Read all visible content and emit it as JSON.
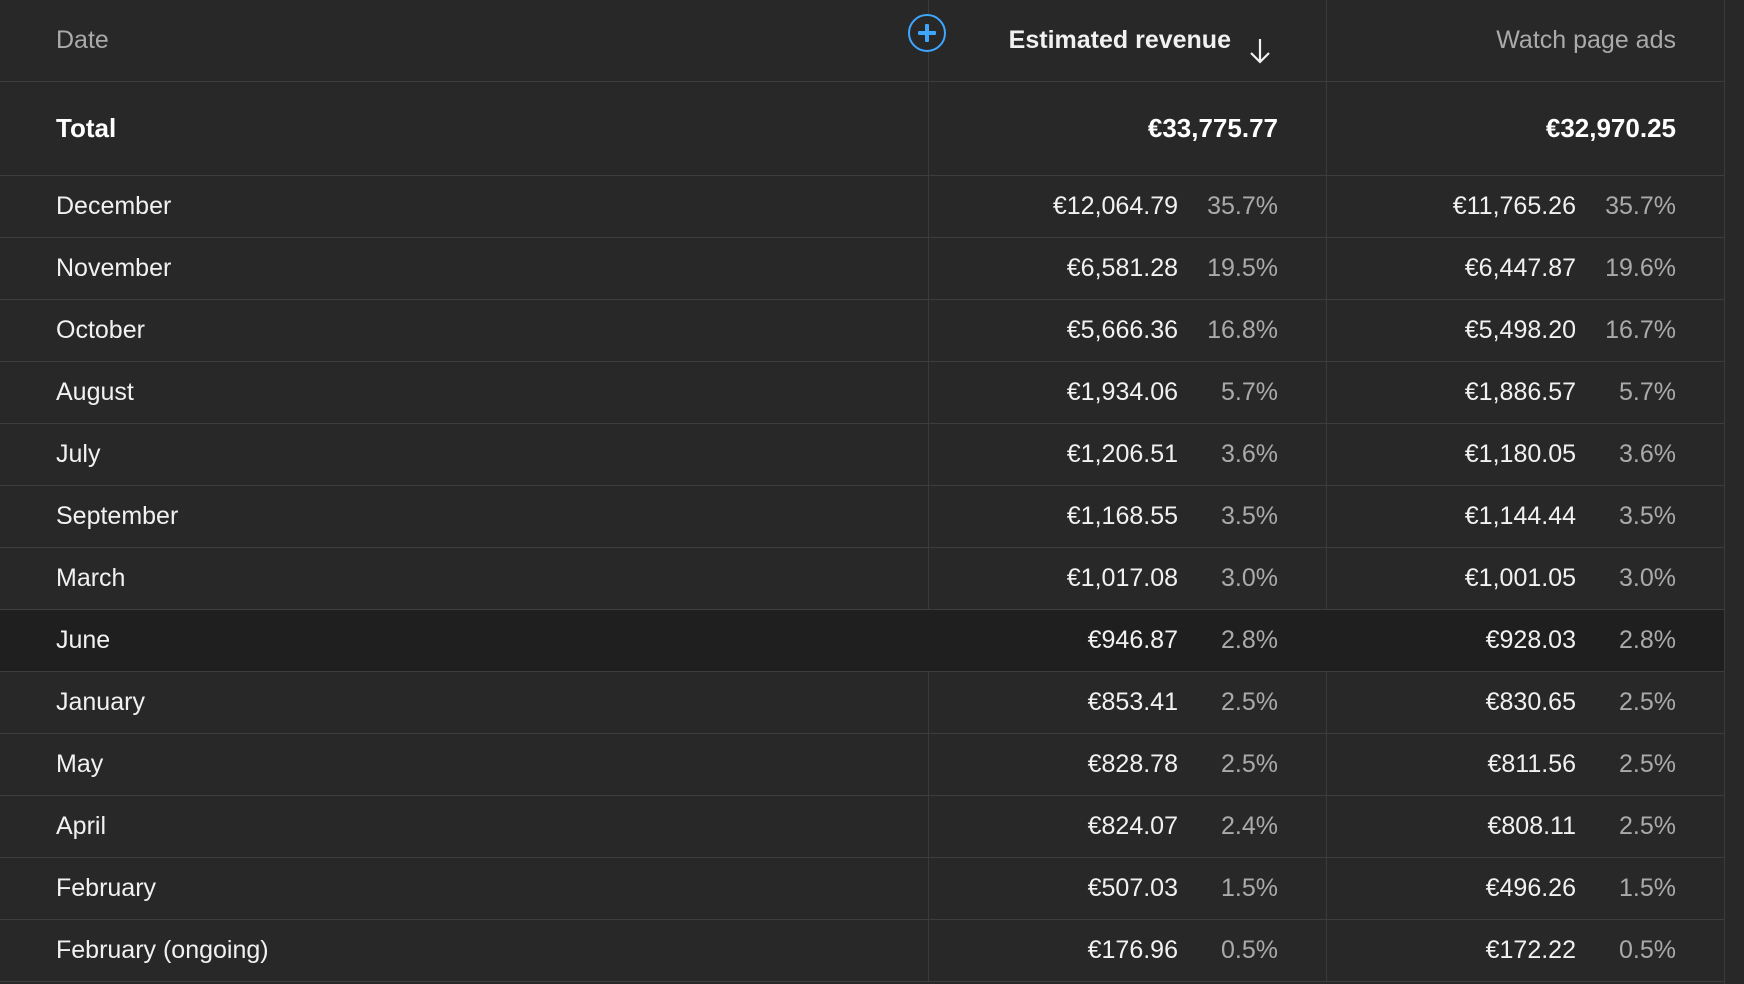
{
  "columns": {
    "date": "Date",
    "revenue": "Estimated revenue",
    "watch_ads": "Watch page ads"
  },
  "icons": {
    "add_column": "plus-circle-icon",
    "sort": "arrow-down-icon"
  },
  "accent_color": "#3ea6ff",
  "total": {
    "label": "Total",
    "revenue": "€33,775.77",
    "watch_ads": "€32,970.25"
  },
  "rows": [
    {
      "date": "December",
      "revenue": "€12,064.79",
      "revenue_pct": "35.7%",
      "watch_ads": "€11,765.26",
      "watch_ads_pct": "35.7%"
    },
    {
      "date": "November",
      "revenue": "€6,581.28",
      "revenue_pct": "19.5%",
      "watch_ads": "€6,447.87",
      "watch_ads_pct": "19.6%"
    },
    {
      "date": "October",
      "revenue": "€5,666.36",
      "revenue_pct": "16.8%",
      "watch_ads": "€5,498.20",
      "watch_ads_pct": "16.7%"
    },
    {
      "date": "August",
      "revenue": "€1,934.06",
      "revenue_pct": "5.7%",
      "watch_ads": "€1,886.57",
      "watch_ads_pct": "5.7%"
    },
    {
      "date": "July",
      "revenue": "€1,206.51",
      "revenue_pct": "3.6%",
      "watch_ads": "€1,180.05",
      "watch_ads_pct": "3.6%"
    },
    {
      "date": "September",
      "revenue": "€1,168.55",
      "revenue_pct": "3.5%",
      "watch_ads": "€1,144.44",
      "watch_ads_pct": "3.5%"
    },
    {
      "date": "March",
      "revenue": "€1,017.08",
      "revenue_pct": "3.0%",
      "watch_ads": "€1,001.05",
      "watch_ads_pct": "3.0%"
    },
    {
      "date": "June",
      "revenue": "€946.87",
      "revenue_pct": "2.8%",
      "watch_ads": "€928.03",
      "watch_ads_pct": "2.8%"
    },
    {
      "date": "January",
      "revenue": "€853.41",
      "revenue_pct": "2.5%",
      "watch_ads": "€830.65",
      "watch_ads_pct": "2.5%"
    },
    {
      "date": "May",
      "revenue": "€828.78",
      "revenue_pct": "2.5%",
      "watch_ads": "€811.56",
      "watch_ads_pct": "2.5%"
    },
    {
      "date": "April",
      "revenue": "€824.07",
      "revenue_pct": "2.4%",
      "watch_ads": "€808.11",
      "watch_ads_pct": "2.5%"
    },
    {
      "date": "February",
      "revenue": "€507.03",
      "revenue_pct": "1.5%",
      "watch_ads": "€496.26",
      "watch_ads_pct": "1.5%"
    },
    {
      "date": "February (ongoing)",
      "revenue": "€176.96",
      "revenue_pct": "0.5%",
      "watch_ads": "€172.22",
      "watch_ads_pct": "0.5%"
    }
  ]
}
